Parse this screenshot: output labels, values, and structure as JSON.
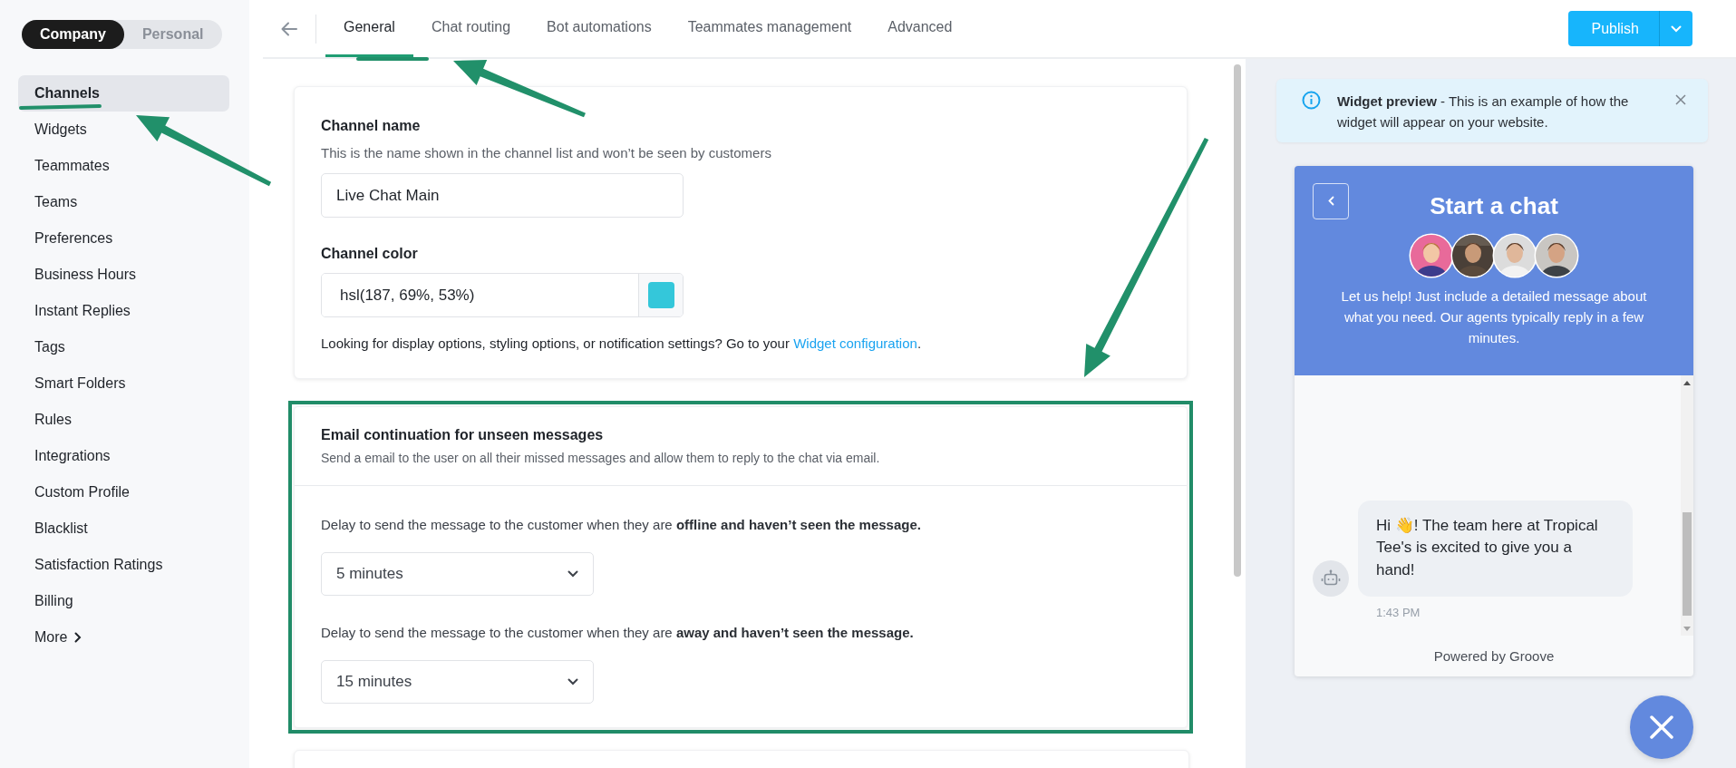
{
  "account_toggle": [
    {
      "label": "Company",
      "selected": true
    },
    {
      "label": "Personal",
      "selected": false
    }
  ],
  "sidebar": {
    "items": [
      {
        "label": "Channels",
        "selected": true,
        "kind": "link"
      },
      {
        "label": "Widgets",
        "selected": false,
        "kind": "link"
      },
      {
        "label": "Teammates",
        "selected": false,
        "kind": "link"
      },
      {
        "label": "Teams",
        "selected": false,
        "kind": "link"
      },
      {
        "label": "Preferences",
        "selected": false,
        "kind": "link"
      },
      {
        "label": "Business Hours",
        "selected": false,
        "kind": "link"
      },
      {
        "label": "Instant Replies",
        "selected": false,
        "kind": "link"
      },
      {
        "label": "Tags",
        "selected": false,
        "kind": "link"
      },
      {
        "label": "Smart Folders",
        "selected": false,
        "kind": "link"
      },
      {
        "label": "Rules",
        "selected": false,
        "kind": "link"
      },
      {
        "label": "Integrations",
        "selected": false,
        "kind": "link"
      },
      {
        "label": "Custom Profile",
        "selected": false,
        "kind": "link"
      },
      {
        "label": "Blacklist",
        "selected": false,
        "kind": "link"
      },
      {
        "label": "Satisfaction Ratings",
        "selected": false,
        "kind": "link"
      },
      {
        "label": "Billing",
        "selected": false,
        "kind": "link"
      },
      {
        "label": "More",
        "selected": false,
        "kind": "more"
      }
    ]
  },
  "tabs": [
    {
      "label": "General",
      "selected": true
    },
    {
      "label": "Chat routing",
      "selected": false
    },
    {
      "label": "Bot automations",
      "selected": false
    },
    {
      "label": "Teammates management",
      "selected": false
    },
    {
      "label": "Advanced",
      "selected": false
    }
  ],
  "publish_button": {
    "label": "Publish"
  },
  "channel_settings": {
    "name_label": "Channel name",
    "name_hint": "This is the name shown in the channel list and won’t be seen by customers",
    "name_value": "Live Chat Main",
    "color_label": "Channel color",
    "color_value": "hsl(187, 69%, 53%)",
    "footer_before": "Looking for display options, styling options, or notification settings? Go to your",
    "footer_link": "Widget configuration",
    "footer_after": "."
  },
  "email_continuation": {
    "title": "Email continuation for unseen messages",
    "description": "Send a email to the user on all their missed messages and allow them to reply to the chat via email.",
    "delays": [
      {
        "text": "Delay to send the message to the customer when they are **offline and haven’t seen the message.**",
        "value": "5 minutes"
      },
      {
        "text": "Delay to send the message to the customer when they are **away and haven’t seen the message.**",
        "value": "15 minutes"
      }
    ]
  },
  "preview_notice": {
    "text": "**Widget preview** - This is an example of how the widget will appear on your website."
  },
  "widget": {
    "title": "Start a chat",
    "intro": "Let us help! Just include a detailed message about what you need. Our agents typically reply in a few minutes.",
    "messages": [
      {
        "text": "Hi 👋! The team here at Tropical Tee's is excited to give you a hand!",
        "time": "1:43 PM"
      }
    ],
    "footer": "Powered by Groove"
  }
}
